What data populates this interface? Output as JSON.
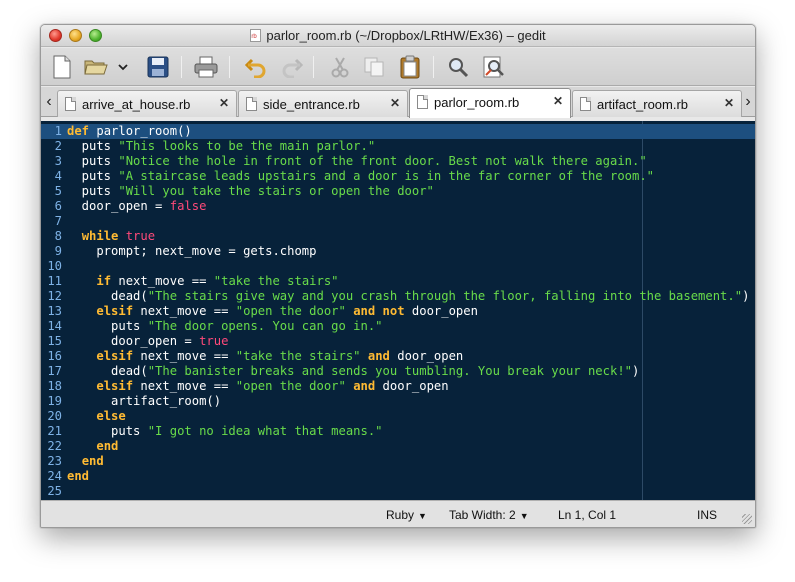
{
  "window": {
    "title": "parlor_room.rb (~/Dropbox/LRtHW/Ex36) – gedit"
  },
  "toolbar": {
    "buttons": [
      "new-document",
      "open",
      "open-dropdown",
      "save",
      "print",
      "undo",
      "redo",
      "cut",
      "copy",
      "paste",
      "find",
      "find-replace"
    ]
  },
  "tabs": [
    {
      "label": "arrive_at_house.rb",
      "active": false
    },
    {
      "label": "side_entrance.rb",
      "active": false
    },
    {
      "label": "parlor_room.rb",
      "active": true
    },
    {
      "label": "artifact_room.rb",
      "active": false
    }
  ],
  "editor": {
    "current_line": 1,
    "lines": [
      "def parlor_room()",
      "  puts \"This looks to be the main parlor.\"",
      "  puts \"Notice the hole in front of the front door. Best not walk there again.\"",
      "  puts \"A staircase leads upstairs and a door is in the far corner of the room.\"",
      "  puts \"Will you take the stairs or open the door\"",
      "  door_open = false",
      "",
      "  while true",
      "    prompt; next_move = gets.chomp",
      "",
      "    if next_move == \"take the stairs\"",
      "      dead(\"The stairs give way and you crash through the floor, falling into the basement.\")",
      "    elsif next_move == \"open the door\" and not door_open",
      "      puts \"The door opens. You can go in.\"",
      "      door_open = true",
      "    elsif next_move == \"take the stairs\" and door_open",
      "      dead(\"The banister breaks and sends you tumbling. You break your neck!\")",
      "    elsif next_move == \"open the door\" and door_open",
      "      artifact_room()",
      "    else",
      "      puts \"I got no idea what that means.\"",
      "    end",
      "  end",
      "end",
      ""
    ]
  },
  "statusbar": {
    "language": "Ruby",
    "tab_width_label": "Tab Width:",
    "tab_width_value": "2",
    "position": "Ln 1, Col 1",
    "mode": "INS"
  },
  "colors": {
    "editor_bg": "#07223a",
    "current_line_bg": "#1d4f7f",
    "keyword": "#ffbb33",
    "string": "#69dc4a",
    "boolean": "#ff4a7a",
    "line_number": "#7eb2e6"
  },
  "icons": {
    "tab_prev": "chevron-left-icon",
    "tab_next": "chevron-right-icon",
    "tab_close": "close-icon",
    "dropdown": "chevron-down-icon"
  }
}
